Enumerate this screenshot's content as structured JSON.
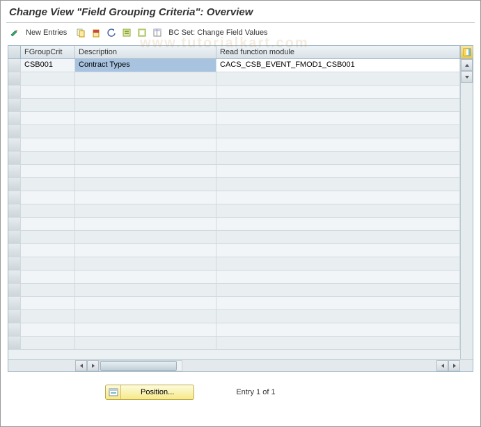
{
  "title": "Change View \"Field Grouping Criteria\": Overview",
  "toolbar": {
    "new_entries": "New Entries",
    "bc_set": "BC Set: Change Field Values"
  },
  "watermark": "www.tutorialkart.com",
  "grid": {
    "columns": {
      "fgroupcrit": "FGroupCrit",
      "description": "Description",
      "read_fm": "Read function module"
    },
    "row": {
      "fgroupcrit": "CSB001",
      "description": "Contract Types",
      "read_fm": "CACS_CSB_EVENT_FMOD1_CSB001"
    }
  },
  "footer": {
    "position": "Position...",
    "entry": "Entry 1 of 1"
  }
}
